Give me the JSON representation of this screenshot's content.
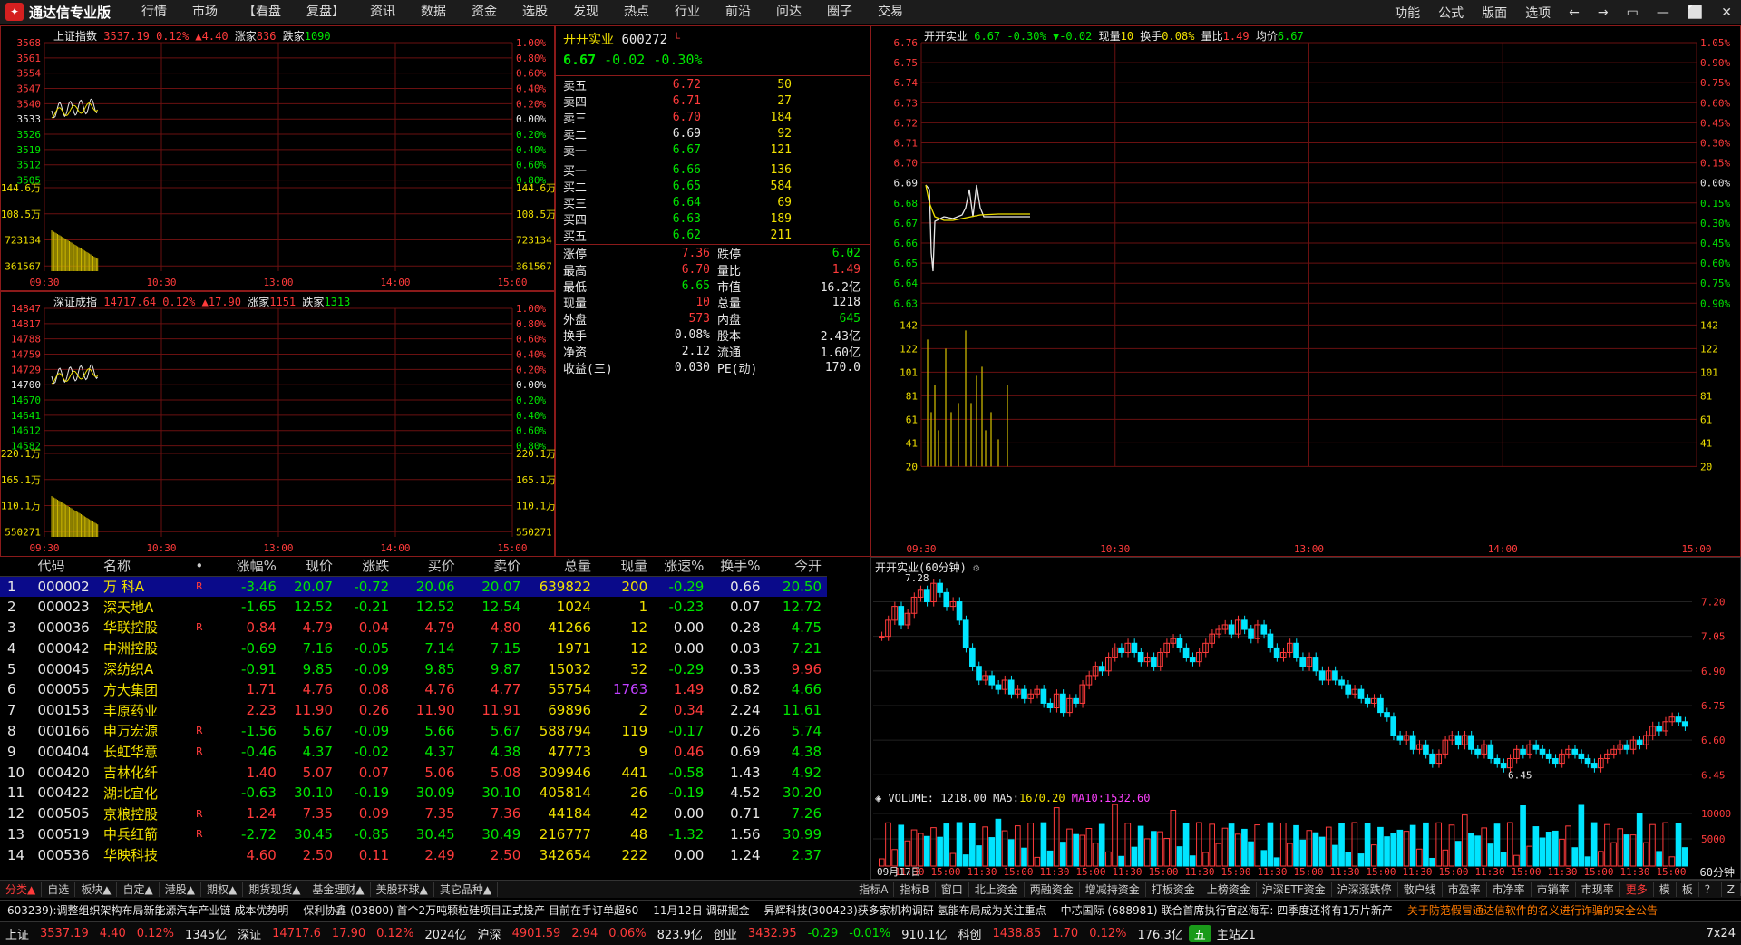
{
  "app": {
    "title": "通达信专业版",
    "menu": [
      "行情",
      "市场",
      "【看盘",
      "复盘】",
      "资讯",
      "数据",
      "资金",
      "选股",
      "发现",
      "热点",
      "行业",
      "前沿",
      "问达",
      "圈子",
      "交易"
    ],
    "right_menu": [
      "功能",
      "公式",
      "版面",
      "选项"
    ]
  },
  "sh_index": {
    "name": "上证指数",
    "price": "3537.19",
    "pct": "0.12%",
    "chg": "▲4.40",
    "up_label": "涨家",
    "up": "836",
    "down_label": "跌家",
    "down": "1090",
    "y_left": [
      "3568",
      "3561",
      "3554",
      "3547",
      "3540",
      "3533",
      "3526",
      "3519",
      "3512",
      "3505",
      "144.6万",
      "108.5万",
      "723134",
      "361567"
    ],
    "y_right": [
      "1.00%",
      "0.80%",
      "0.60%",
      "0.40%",
      "0.20%",
      "0.00%",
      "0.20%",
      "0.40%",
      "0.60%",
      "0.80%",
      "144.6万",
      "108.5万",
      "723134",
      "361567"
    ],
    "times": [
      "09:30",
      "10:30",
      "13:00",
      "14:00",
      "15:00"
    ]
  },
  "sz_index": {
    "name": "深证成指",
    "price": "14717.64",
    "pct": "0.12%",
    "chg": "▲17.90",
    "up_label": "涨家",
    "up": "1151",
    "down_label": "跌家",
    "down": "1313",
    "y_left": [
      "14847",
      "14817",
      "14788",
      "14759",
      "14729",
      "14700",
      "14670",
      "14641",
      "14612",
      "14582",
      "220.1万",
      "165.1万",
      "110.1万",
      "550271"
    ],
    "y_right": [
      "1.00%",
      "0.80%",
      "0.60%",
      "0.40%",
      "0.20%",
      "0.00%",
      "0.20%",
      "0.40%",
      "0.60%",
      "0.80%",
      "220.1万",
      "165.1万",
      "110.1万",
      "550271"
    ],
    "times": [
      "09:30",
      "10:30",
      "13:00",
      "14:00",
      "15:00"
    ]
  },
  "quote": {
    "name": "开开实业",
    "code": "600272",
    "flag": "L",
    "price": "6.67",
    "chg": "-0.02",
    "pct": "-0.30%",
    "asks": [
      {
        "label": "卖五",
        "price": "6.72",
        "vol": "50"
      },
      {
        "label": "卖四",
        "price": "6.71",
        "vol": "27"
      },
      {
        "label": "卖三",
        "price": "6.70",
        "vol": "184"
      },
      {
        "label": "卖二",
        "price": "6.69",
        "vol": "92"
      },
      {
        "label": "卖一",
        "price": "6.67",
        "vol": "121"
      }
    ],
    "bids": [
      {
        "label": "买一",
        "price": "6.66",
        "vol": "136"
      },
      {
        "label": "买二",
        "price": "6.65",
        "vol": "584"
      },
      {
        "label": "买三",
        "price": "6.64",
        "vol": "69"
      },
      {
        "label": "买四",
        "price": "6.63",
        "vol": "189"
      },
      {
        "label": "买五",
        "price": "6.62",
        "vol": "211"
      }
    ],
    "stats1": [
      [
        "涨停",
        "7.36",
        "跌停",
        "6.02"
      ],
      [
        "最高",
        "6.70",
        "量比",
        "1.49"
      ],
      [
        "最低",
        "6.65",
        "市值",
        "16.2亿"
      ],
      [
        "现量",
        "10",
        "总量",
        "1218"
      ],
      [
        "外盘",
        "573",
        "内盘",
        "645"
      ]
    ],
    "stats2": [
      [
        "换手",
        "0.08%",
        "股本",
        "2.43亿"
      ],
      [
        "净资",
        "2.12",
        "流通",
        "1.60亿"
      ],
      [
        "收益(三)",
        "0.030",
        "PE(动)",
        "170.0"
      ]
    ]
  },
  "intraday": {
    "header": {
      "name": "开开实业",
      "price": "6.67",
      "pct": "-0.30%",
      "chg": "▼-0.02",
      "vol_label": "现量",
      "vol": "10",
      "turn_label": "换手",
      "turn": "0.08%",
      "ratio_label": "量比",
      "ratio": "1.49",
      "avg_label": "均价",
      "avg": "6.67"
    },
    "y_left": [
      "6.76",
      "6.75",
      "6.74",
      "6.73",
      "6.72",
      "6.71",
      "6.70",
      "6.69",
      "6.68",
      "6.67",
      "6.66",
      "6.65",
      "6.64",
      "6.63",
      "142",
      "122",
      "101",
      "81",
      "61",
      "41",
      "20"
    ],
    "y_right": [
      "1.05%",
      "0.90%",
      "0.75%",
      "0.60%",
      "0.45%",
      "0.30%",
      "0.15%",
      "0.00%",
      "0.15%",
      "0.30%",
      "0.45%",
      "0.60%",
      "0.75%",
      "0.90%",
      "142",
      "122",
      "101",
      "81",
      "61",
      "41",
      "20"
    ],
    "times": [
      "09:30",
      "10:30",
      "13:00",
      "14:00",
      "15:00"
    ]
  },
  "stocks": {
    "headers": [
      "",
      "代码",
      "名称",
      "•",
      "涨幅%",
      "现价",
      "涨跌",
      "买价",
      "卖价",
      "总量",
      "现量",
      "涨速%",
      "换手%",
      "今开"
    ],
    "rows": [
      [
        "1",
        "000002",
        "万 科A",
        "R",
        "-3.46",
        "20.07",
        "-0.72",
        "20.06",
        "20.07",
        "639822",
        "200",
        "-0.29",
        "0.66",
        "20.50"
      ],
      [
        "2",
        "000023",
        "深天地A",
        "",
        "-1.65",
        "12.52",
        "-0.21",
        "12.52",
        "12.54",
        "1024",
        "1",
        "-0.23",
        "0.07",
        "12.72"
      ],
      [
        "3",
        "000036",
        "华联控股",
        "R",
        "0.84",
        "4.79",
        "0.04",
        "4.79",
        "4.80",
        "41266",
        "12",
        "0.00",
        "0.28",
        "4.75"
      ],
      [
        "4",
        "000042",
        "中洲控股",
        "",
        "-0.69",
        "7.16",
        "-0.05",
        "7.14",
        "7.15",
        "1971",
        "12",
        "0.00",
        "0.03",
        "7.21"
      ],
      [
        "5",
        "000045",
        "深纺织A",
        "",
        "-0.91",
        "9.85",
        "-0.09",
        "9.85",
        "9.87",
        "15032",
        "32",
        "-0.29",
        "0.33",
        "9.96"
      ],
      [
        "6",
        "000055",
        "方大集团",
        "",
        "1.71",
        "4.76",
        "0.08",
        "4.76",
        "4.77",
        "55754",
        "1763",
        "1.49",
        "0.82",
        "4.66"
      ],
      [
        "7",
        "000153",
        "丰原药业",
        "",
        "2.23",
        "11.90",
        "0.26",
        "11.90",
        "11.91",
        "69896",
        "2",
        "0.34",
        "2.24",
        "11.61"
      ],
      [
        "8",
        "000166",
        "申万宏源",
        "R",
        "-1.56",
        "5.67",
        "-0.09",
        "5.66",
        "5.67",
        "588794",
        "119",
        "-0.17",
        "0.26",
        "5.74"
      ],
      [
        "9",
        "000404",
        "长虹华意",
        "R",
        "-0.46",
        "4.37",
        "-0.02",
        "4.37",
        "4.38",
        "47773",
        "9",
        "0.46",
        "0.69",
        "4.38"
      ],
      [
        "10",
        "000420",
        "吉林化纤",
        "",
        "1.40",
        "5.07",
        "0.07",
        "5.06",
        "5.08",
        "309946",
        "441",
        "-0.58",
        "1.43",
        "4.92"
      ],
      [
        "11",
        "000422",
        "湖北宜化",
        "",
        "-0.63",
        "30.10",
        "-0.19",
        "30.09",
        "30.10",
        "405814",
        "26",
        "-0.19",
        "4.52",
        "30.20"
      ],
      [
        "12",
        "000505",
        "京粮控股",
        "R",
        "1.24",
        "7.35",
        "0.09",
        "7.35",
        "7.36",
        "44184",
        "42",
        "0.00",
        "0.71",
        "7.26"
      ],
      [
        "13",
        "000519",
        "中兵红箭",
        "R",
        "-2.72",
        "30.45",
        "-0.85",
        "30.45",
        "30.49",
        "216777",
        "48",
        "-1.32",
        "1.56",
        "30.99"
      ],
      [
        "14",
        "000536",
        "华映科技",
        "",
        "4.60",
        "2.50",
        "0.11",
        "2.49",
        "2.50",
        "342654",
        "222",
        "0.00",
        "1.24",
        "2.37"
      ]
    ]
  },
  "kline": {
    "title": "开开实业(60分钟)",
    "high_label": "7.28",
    "low_label": "6.45",
    "date_label": "09月17日",
    "y_right": [
      "7.20",
      "7.05",
      "6.90",
      "6.75",
      "6.60",
      "6.45"
    ],
    "vol_header": {
      "label": "VOLUME:",
      "vol": "1218.00",
      "ma5_label": "MA5:",
      "ma5": "1670.20",
      "ma10_label": "MA10:",
      "ma10": "1532.60"
    },
    "vol_y": [
      "10000",
      "5000"
    ],
    "times": [
      "11:30",
      "15:00",
      "11:30",
      "15:00",
      "11:30",
      "15:00",
      "11:30",
      "15:00",
      "11:30",
      "15:00",
      "11:30",
      "15:00",
      "11:30",
      "15:00",
      "11:30",
      "15:00",
      "11:30",
      "15:00",
      "11:30",
      "15:00",
      "11:30",
      "15:00"
    ],
    "period": "60分钟",
    "close_series": [
      7.05,
      7.12,
      7.18,
      7.1,
      7.15,
      7.22,
      7.25,
      7.2,
      7.28,
      7.24,
      7.18,
      7.2,
      7.12,
      7.0,
      6.92,
      6.86,
      6.88,
      6.84,
      6.82,
      6.86,
      6.8,
      6.82,
      6.78,
      6.8,
      6.82,
      6.76,
      6.74,
      6.8,
      6.72,
      6.78,
      6.76,
      6.84,
      6.88,
      6.92,
      6.9,
      6.96,
      7.0,
      6.98,
      7.02,
      6.98,
      6.94,
      6.96,
      6.92,
      6.98,
      7.02,
      7.04,
      7.0,
      6.96,
      6.94,
      6.98,
      7.02,
      7.06,
      7.08,
      7.1,
      7.06,
      7.12,
      7.08,
      7.04,
      7.1,
      7.06,
      7.0,
      6.96,
      6.98,
      7.02,
      6.96,
      6.92,
      6.96,
      6.9,
      6.86,
      6.9,
      6.86,
      6.84,
      6.8,
      6.82,
      6.78,
      6.76,
      6.78,
      6.72,
      6.7,
      6.62,
      6.6,
      6.62,
      6.56,
      6.58,
      6.54,
      6.5,
      6.54,
      6.6,
      6.62,
      6.58,
      6.62,
      6.56,
      6.54,
      6.58,
      6.52,
      6.5,
      6.48,
      6.52,
      6.56,
      6.54,
      6.58,
      6.56,
      6.54,
      6.52,
      6.5,
      6.54,
      6.56,
      6.54,
      6.52,
      6.5,
      6.48,
      6.52,
      6.54,
      6.56,
      6.58,
      6.56,
      6.6,
      6.58,
      6.62,
      6.66,
      6.64,
      6.68,
      6.7,
      6.68,
      6.66
    ]
  },
  "bottom_tabs": [
    "分类▲",
    "自选",
    "板块▲",
    "自定▲",
    "港股▲",
    "期权▲",
    "期货现货▲",
    "基金理财▲",
    "美股环球▲",
    "其它品种▲"
  ],
  "right_tabs": [
    "指标A",
    "指标B",
    "窗口",
    "北上资金",
    "两融资金",
    "增减持资金",
    "打板资金",
    "上榜资金",
    "沪深ETF资金",
    "沪深涨跌停",
    "散户线",
    "市盈率",
    "市净率",
    "市销率",
    "市现率",
    "更多"
  ],
  "right_tabs_extra": [
    "模",
    "板",
    "？",
    "Z"
  ],
  "ticker": [
    "603239):调整组织架构布局新能源汽车产业链 成本优势明",
    "保利协鑫 (03800) 首个2万吨颗粒硅项目正式投产 目前在手订单超60",
    "11月12日 调研掘金",
    "昇辉科技(300423)获多家机构调研 氢能布局成为关注重点",
    "中芯国际 (688981) 联合首席执行官赵海军: 四季度还将有1万片新产",
    "关于防范假冒通达信软件的名义进行诈骗的安全公告"
  ],
  "status": {
    "sh_label": "上证",
    "sh_price": "3537.19",
    "sh_chg": "4.40",
    "sh_pct": "0.12%",
    "sh_amt": "1345亿",
    "sz_label": "深证",
    "sz_price": "14717.6",
    "sz_chg": "17.90",
    "sz_pct": "0.12%",
    "sz_amt": "2024亿",
    "hs_label": "沪深",
    "hs_price": "4901.59",
    "hs_chg": "2.94",
    "hs_pct": "0.06%",
    "hs_amt": "823.9亿",
    "cy_label": "创业",
    "cy_price": "3432.95",
    "cy_chg": "-0.29",
    "cy_pct": "-0.01%",
    "cy_amt": "910.1亿",
    "kc_label": "科创",
    "kc_price": "1438.85",
    "kc_chg": "1.70",
    "kc_pct": "0.12%",
    "kc_amt": "176.3亿",
    "ime": "五",
    "site": "主站Z1",
    "clock": "7x24"
  }
}
